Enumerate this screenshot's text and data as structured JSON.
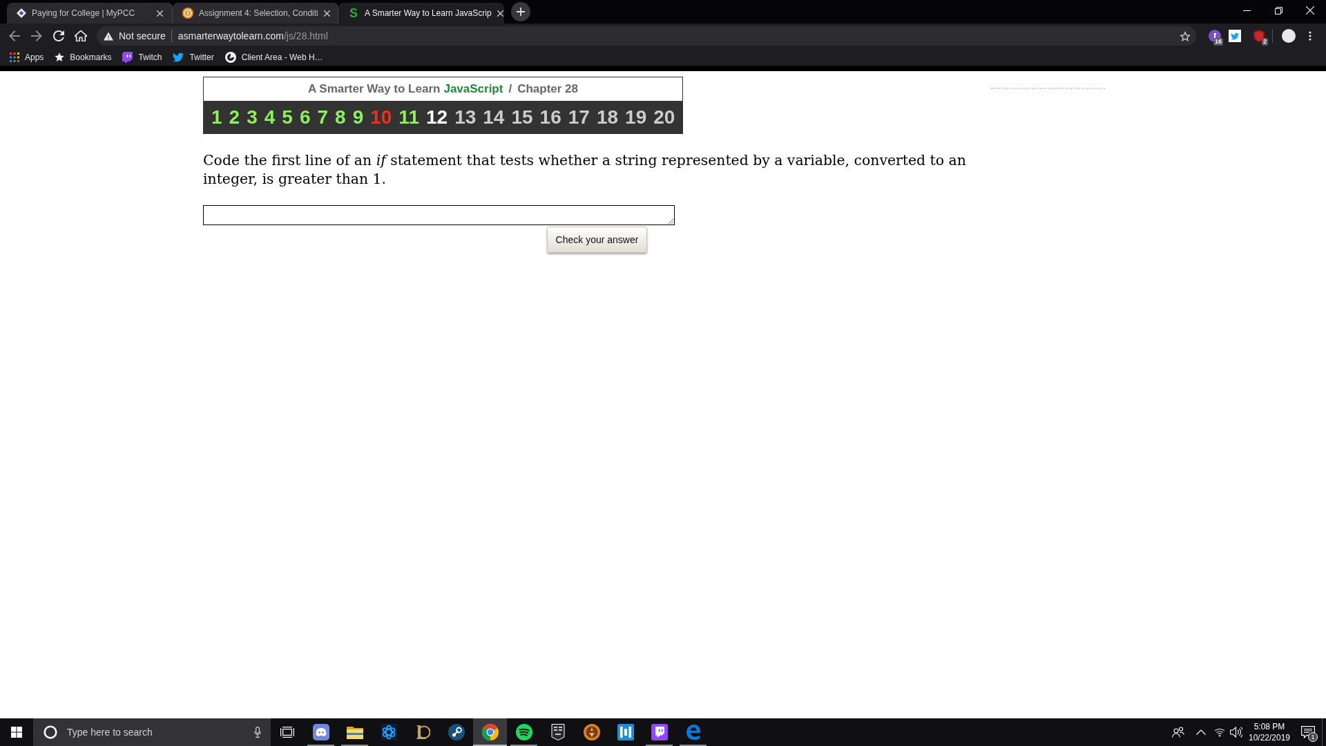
{
  "browser": {
    "tabs": [
      {
        "kind": "diamond",
        "title": "Paying for College | MyPCC",
        "selected": false
      },
      {
        "kind": "circle",
        "title": "Assignment 4: Selection, Conditi",
        "selected": false
      },
      {
        "kind": "letter",
        "icon_text": "S",
        "title": "A Smarter Way to Learn JavaScrip",
        "selected": true
      }
    ],
    "address_bar": {
      "security": "Not secure",
      "host": "asmarterwaytolearn.com",
      "path": "/js/28.html"
    },
    "extensions": [
      {
        "kind": "circle",
        "badge": "16"
      },
      {
        "kind": "bird"
      },
      {
        "kind": "shield",
        "badge": "2"
      }
    ],
    "bookmarks": [
      {
        "kind": "apps",
        "label": "Apps"
      },
      {
        "kind": "star",
        "label": "Bookmarks"
      },
      {
        "kind": "twitch",
        "label": "Twitch"
      },
      {
        "kind": "bird",
        "label": "Twitter"
      },
      {
        "kind": "globe",
        "label": "Client Area - Web H…"
      }
    ]
  },
  "page": {
    "header": {
      "title": "A Smarter Way to Learn",
      "language": "JavaScript",
      "separator": "/",
      "chapter": "Chapter 28"
    },
    "chapters": [
      {
        "label": "1",
        "color": "#8ef05c"
      },
      {
        "label": "2",
        "color": "#8ef05c"
      },
      {
        "label": "3",
        "color": "#8ef05c"
      },
      {
        "label": "4",
        "color": "#8ef05c"
      },
      {
        "label": "5",
        "color": "#8ef05c"
      },
      {
        "label": "6",
        "color": "#8ef05c"
      },
      {
        "label": "7",
        "color": "#8ef05c"
      },
      {
        "label": "8",
        "color": "#8ef05c"
      },
      {
        "label": "9",
        "color": "#8ef05c"
      },
      {
        "label": "10",
        "color": "#e8321e"
      },
      {
        "label": "11",
        "color": "#8ef05c"
      },
      {
        "label": "12",
        "color": "#ffffff"
      },
      {
        "label": "13",
        "color": "#cccccc"
      },
      {
        "label": "14",
        "color": "#cccccc"
      },
      {
        "label": "15",
        "color": "#cccccc"
      },
      {
        "label": "16",
        "color": "#cccccc"
      },
      {
        "label": "17",
        "color": "#cccccc"
      },
      {
        "label": "18",
        "color": "#cccccc"
      },
      {
        "label": "19",
        "color": "#cccccc"
      },
      {
        "label": "20",
        "color": "#cccccc"
      }
    ],
    "question": "Code the first line of an *if* statement that tests whether a string represented by a variable, converted to an integer, is greater than 1.",
    "check_button": "Check your answer"
  },
  "taskbar": {
    "search": {
      "placeholder": "Type here to search"
    },
    "apps": [
      {
        "kind": "discord",
        "running": true,
        "selected": false
      },
      {
        "kind": "folder",
        "running": true,
        "selected": false
      },
      {
        "kind": "swirl",
        "running": false,
        "selected": false
      },
      {
        "kind": "emblem",
        "running": false,
        "selected": false
      },
      {
        "kind": "steam",
        "running": false,
        "selected": false
      },
      {
        "kind": "chrome",
        "running": true,
        "selected": true
      },
      {
        "kind": "spotify",
        "running": true,
        "selected": false
      },
      {
        "kind": "shield",
        "running": false,
        "selected": false
      },
      {
        "kind": "medallion",
        "running": false,
        "selected": false
      },
      {
        "kind": "bracket",
        "running": false,
        "selected": false
      },
      {
        "kind": "twitch",
        "running": true,
        "selected": false
      },
      {
        "kind": "edge",
        "running": true,
        "selected": false
      }
    ],
    "clock": {
      "time": "5:08 PM",
      "date": "10/22/2019"
    },
    "notification_badge": "1"
  }
}
